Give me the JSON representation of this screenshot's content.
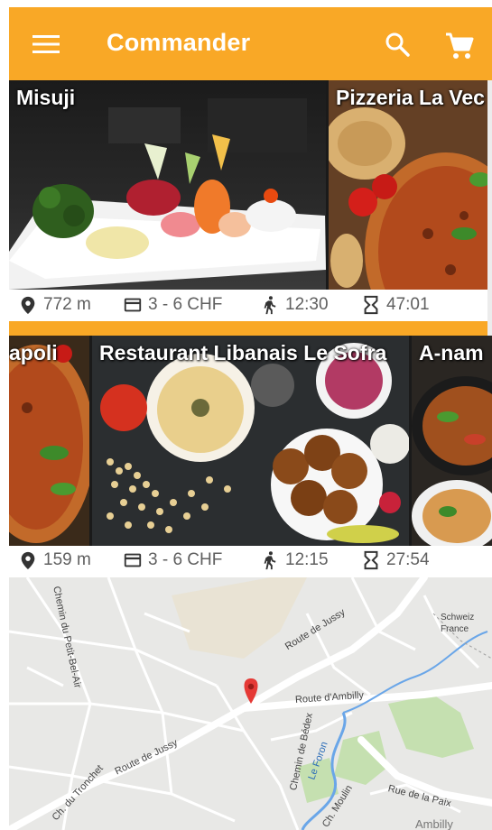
{
  "app_bar": {
    "title": "Commander",
    "background": "#F9A826",
    "icons": [
      "menu-icon",
      "search-icon",
      "cart-icon"
    ]
  },
  "restaurants_row_1": [
    {
      "name": "Misuji",
      "distance": "772 m",
      "price": "3 - 6 CHF",
      "pickup_time": "12:30",
      "countdown": "47:01"
    },
    {
      "name": "Pizzeria La Vec"
    }
  ],
  "restaurants_row_2": [
    {
      "name": "apoli"
    },
    {
      "name": "Restaurant Libanais Le Sofra",
      "distance": "159 m",
      "price": "3 - 6 CHF",
      "pickup_time": "12:15",
      "countdown": "27:54"
    },
    {
      "name": "A-nam"
    }
  ],
  "info_icons": [
    "location-pin-icon",
    "card-icon",
    "walking-person-icon",
    "hourglass-icon"
  ],
  "map": {
    "labels": [
      "Chemin du Petit-Bel-Air",
      "Route de Jussy",
      "Route de Jussy",
      "Route d'Ambilly",
      "Chemin de Bédex",
      "Schweiz France",
      "Rue de la Paix",
      "Le Foron",
      "Ch. du Tronchet",
      "Ch. Moulin",
      "Ambilly"
    ],
    "marker_color": "#E53935"
  }
}
